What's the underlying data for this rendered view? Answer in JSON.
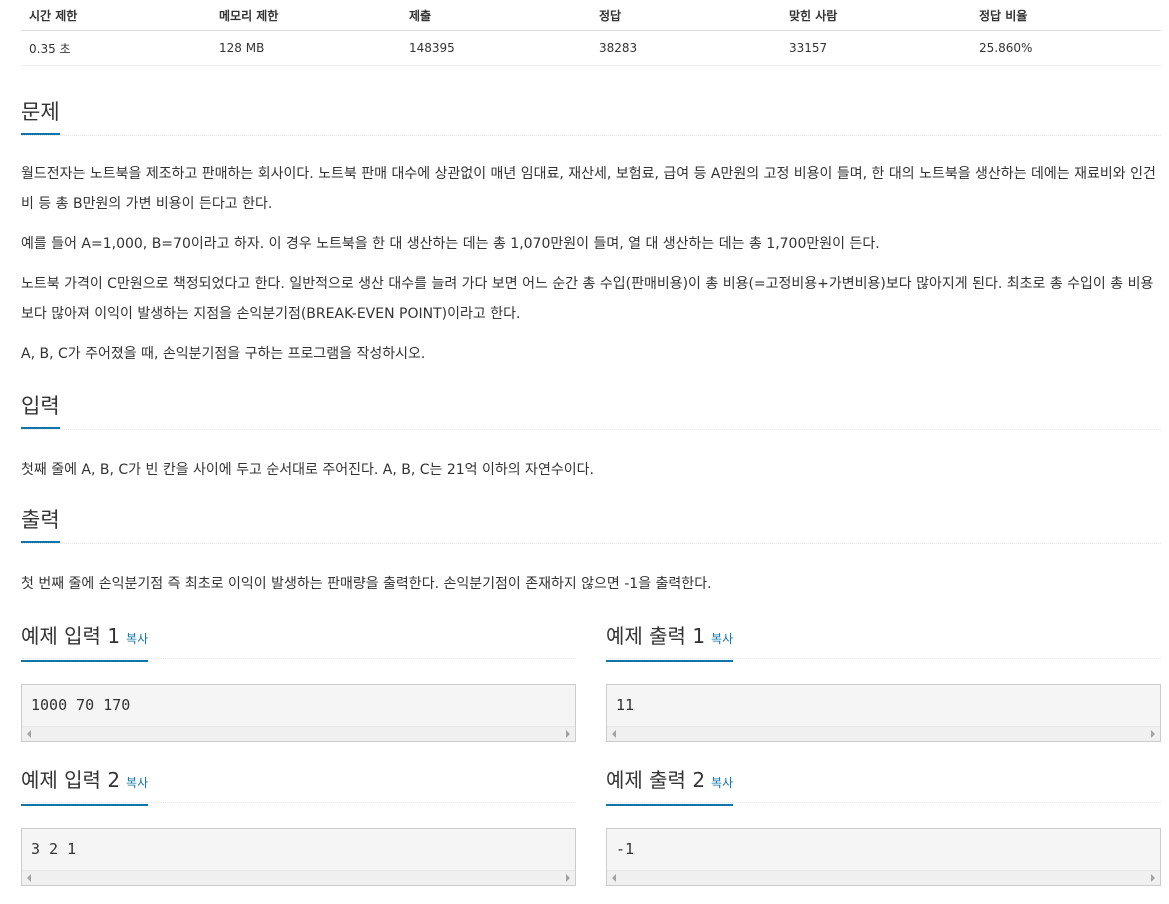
{
  "stats": {
    "headers": [
      "시간 제한",
      "메모리 제한",
      "제출",
      "정답",
      "맞힌 사람",
      "정답 비율"
    ],
    "values": [
      "0.35 초",
      "128 MB",
      "148395",
      "38283",
      "33157",
      "25.860%"
    ]
  },
  "problem": {
    "title": "문제",
    "paragraphs": [
      "월드전자는 노트북을 제조하고 판매하는 회사이다. 노트북 판매 대수에 상관없이 매년 임대료, 재산세, 보험료, 급여 등 A만원의 고정 비용이 들며, 한 대의 노트북을 생산하는 데에는 재료비와 인건비 등 총 B만원의 가변 비용이 든다고 한다.",
      "예를 들어 A=1,000, B=70이라고 하자. 이 경우 노트북을 한 대 생산하는 데는 총 1,070만원이 들며, 열 대 생산하는 데는 총 1,700만원이 든다.",
      "노트북 가격이 C만원으로 책정되었다고 한다. 일반적으로 생산 대수를 늘려 가다 보면 어느 순간 총 수입(판매비용)이 총 비용(=고정비용+가변비용)보다 많아지게 된다. 최초로 총 수입이 총 비용보다 많아져 이익이 발생하는 지점을 손익분기점(BREAK-EVEN POINT)이라고 한다.",
      "A, B, C가 주어졌을 때, 손익분기점을 구하는 프로그램을 작성하시오."
    ]
  },
  "input": {
    "title": "입력",
    "text": "첫째 줄에 A, B, C가 빈 칸을 사이에 두고 순서대로 주어진다. A, B, C는 21억 이하의 자연수이다."
  },
  "output": {
    "title": "출력",
    "text": "첫 번째 줄에 손익분기점 즉 최초로 이익이 발생하는 판매량을 출력한다. 손익분기점이 존재하지 않으면 -1을 출력한다."
  },
  "copy_label": "복사",
  "samples": [
    {
      "input_title": "예제 입력 1",
      "input": "1000 70 170",
      "output_title": "예제 출력 1",
      "output": "11"
    },
    {
      "input_title": "예제 입력 2",
      "input": "3 2 1",
      "output_title": "예제 출력 2",
      "output": "-1"
    }
  ]
}
